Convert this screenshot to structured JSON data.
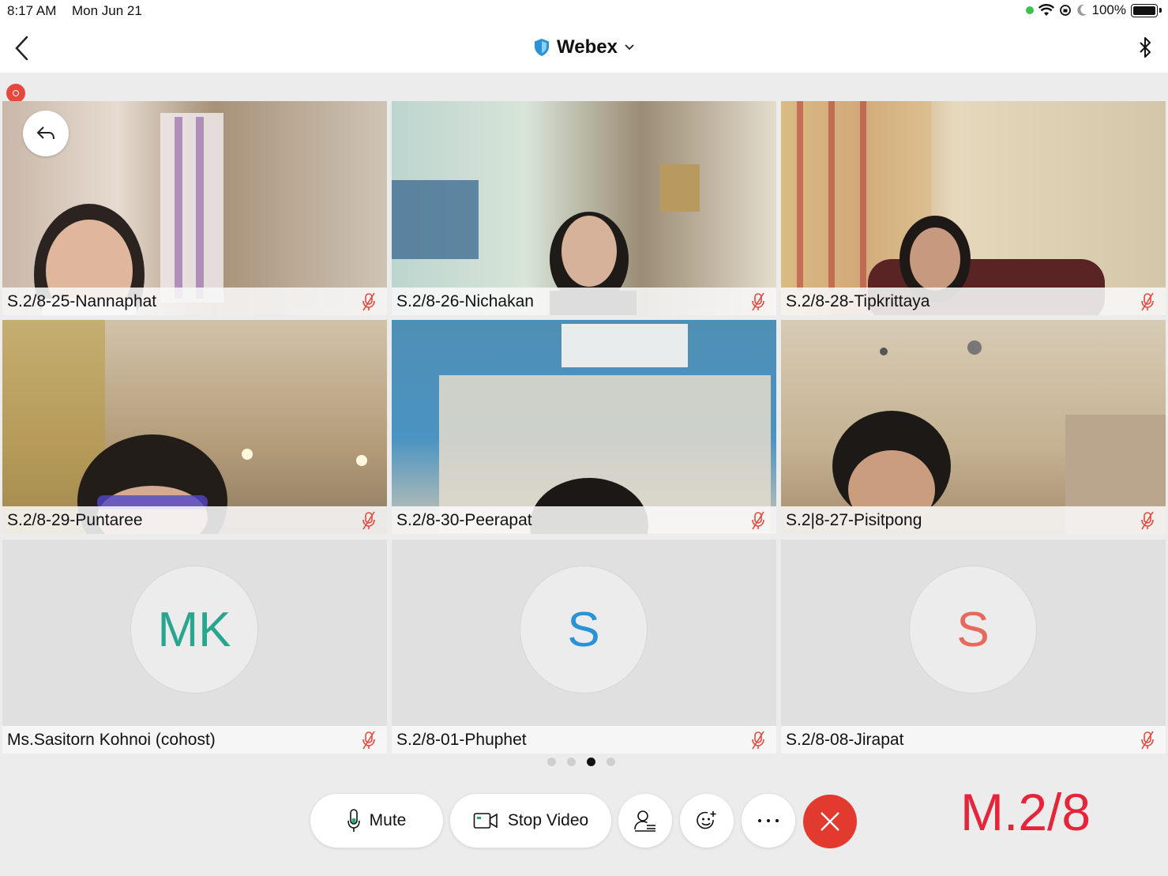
{
  "status_bar": {
    "time": "8:17 AM",
    "date": "Mon Jun 21",
    "battery": "100%"
  },
  "nav": {
    "title": "Webex"
  },
  "colors": {
    "accent_red": "#e23a2e",
    "mute_icon": "#e5483d",
    "mk_avatar": "#2aa58f",
    "s_blue": "#2a93d5",
    "s_red": "#e8685d"
  },
  "participants": [
    {
      "name": "S.2/8-25-Nannaphat",
      "muted": true
    },
    {
      "name": "S.2/8-26-Nichakan",
      "muted": true
    },
    {
      "name": "S.2/8-28-Tipkrittaya",
      "muted": true
    },
    {
      "name": "S.2/8-29-Puntaree",
      "muted": true
    },
    {
      "name": "S.2/8-30-Peerapat",
      "muted": true
    },
    {
      "name": "S.2|8-27-Pisitpong",
      "muted": true
    },
    {
      "name": "Ms.Sasitorn Kohnoi (cohost)",
      "initials": "MK",
      "muted": true
    },
    {
      "name": "S.2/8-01-Phuphet",
      "initials": "S",
      "muted": true
    },
    {
      "name": "S.2/8-08-Jirapat",
      "initials": "S",
      "muted": true
    }
  ],
  "pagination": {
    "pages": 4,
    "current": 3
  },
  "controls": {
    "mute": "Mute",
    "stop_video": "Stop Video"
  },
  "overlay_label": "M.2/8"
}
